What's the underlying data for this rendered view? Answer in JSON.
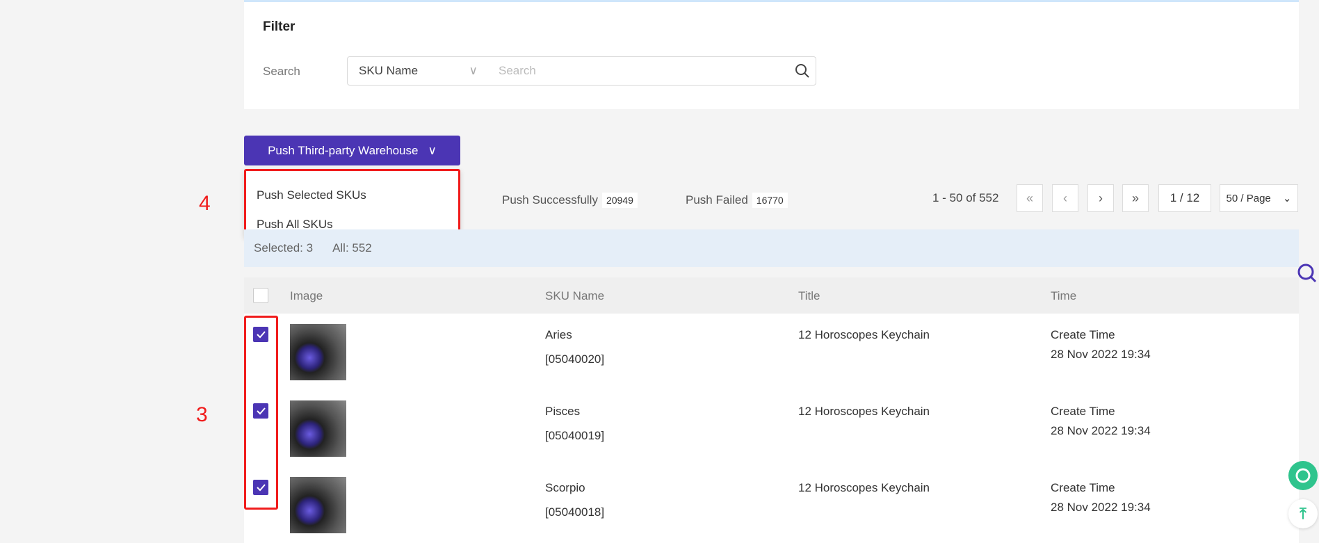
{
  "filter": {
    "title": "Filter",
    "search_label": "Search",
    "field_select": "SKU Name",
    "search_placeholder": "Search"
  },
  "actions": {
    "push_button": "Push Third-party Warehouse",
    "menu": [
      "Push Selected SKUs",
      "Push All SKUs"
    ]
  },
  "stats": {
    "success_label": "Push Successfully",
    "success_count": "20949",
    "failed_label": "Push Failed",
    "failed_count": "16770"
  },
  "pagination": {
    "range": "1 - 50 of 552",
    "page": "1 / 12",
    "per_page": "50 / Page"
  },
  "selection": {
    "selected": "Selected: 3",
    "all": "All: 552"
  },
  "table": {
    "columns": [
      "Image",
      "SKU Name",
      "Title",
      "Time"
    ],
    "rows": [
      {
        "name": "Aries",
        "code": "[05040020]",
        "title": "12 Horoscopes Keychain",
        "time_label": "Create Time",
        "time": "28 Nov 2022 19:34",
        "checked": true
      },
      {
        "name": "Pisces",
        "code": "[05040019]",
        "title": "12 Horoscopes Keychain",
        "time_label": "Create Time",
        "time": "28 Nov 2022 19:34",
        "checked": true
      },
      {
        "name": "Scorpio",
        "code": "[05040018]",
        "title": "12 Horoscopes Keychain",
        "time_label": "Create Time",
        "time": "28 Nov 2022 19:34",
        "checked": true
      }
    ]
  },
  "annotations": [
    "4",
    "3"
  ],
  "colors": {
    "primary": "#4b35b4",
    "annotation": "#f01c1c",
    "support": "#2fc48d"
  }
}
